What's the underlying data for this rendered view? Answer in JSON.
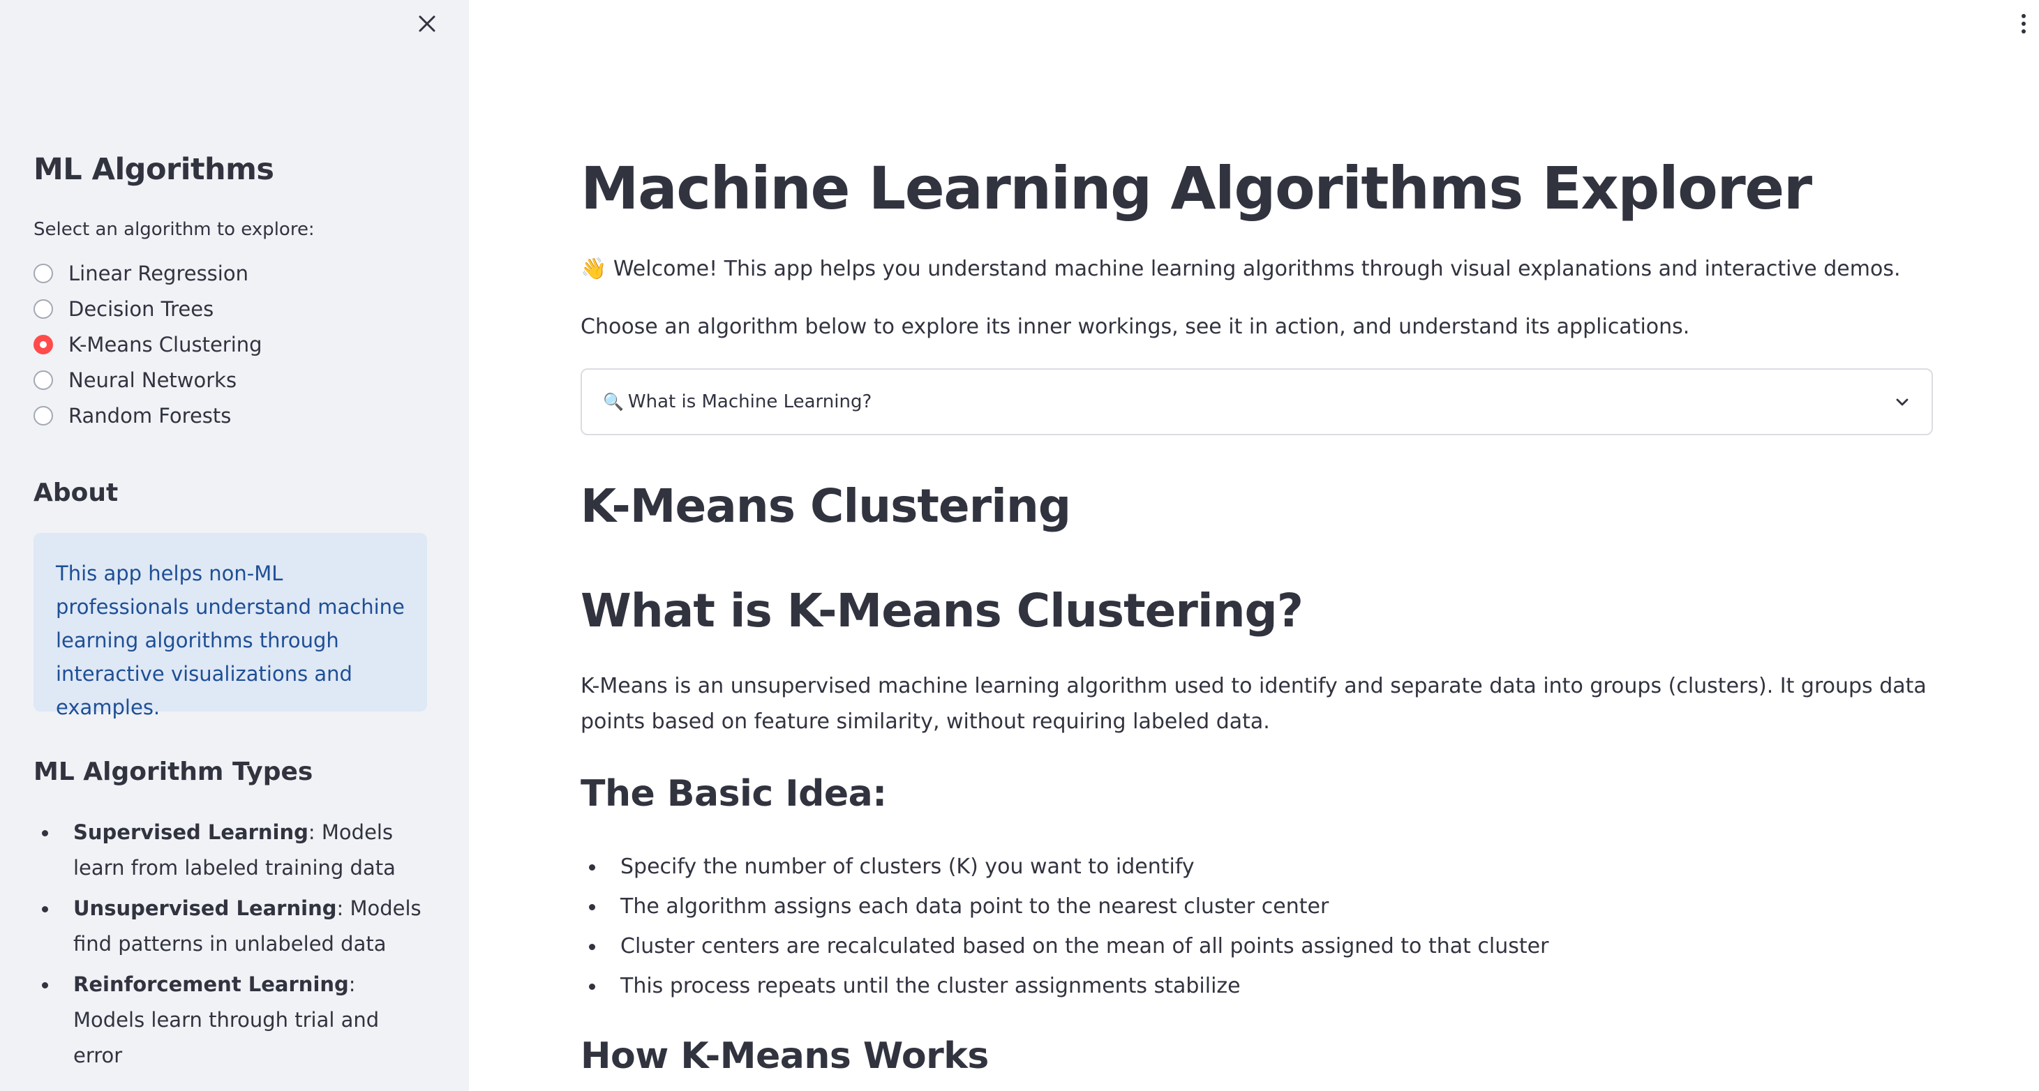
{
  "sidebar": {
    "title": "ML Algorithms",
    "prompt": "Select an algorithm to explore:",
    "options": [
      {
        "label": "Linear Regression",
        "checked": false
      },
      {
        "label": "Decision Trees",
        "checked": false
      },
      {
        "label": "K-Means Clustering",
        "checked": true
      },
      {
        "label": "Neural Networks",
        "checked": false
      },
      {
        "label": "Random Forests",
        "checked": false
      }
    ],
    "about_heading": "About",
    "about_text": "This app helps non-ML professionals understand machine learning algorithms through interactive visualizations and examples.",
    "types_heading": "ML Algorithm Types",
    "types": [
      {
        "name": "Supervised Learning",
        "desc": ": Models learn from labeled training data"
      },
      {
        "name": "Unsupervised Learning",
        "desc": ": Models find patterns in unlabeled data"
      },
      {
        "name": "Reinforcement Learning",
        "desc": ": Models learn through trial and error"
      }
    ]
  },
  "main": {
    "title": "Machine Learning Algorithms Explorer",
    "welcome_emoji": "👋",
    "welcome": "Welcome! This app helps you understand machine learning algorithms through visual explanations and interactive demos.",
    "choose": "Choose an algorithm below to explore its inner workings, see it in action, and understand its applications.",
    "expander_icon": "🔍",
    "expander_label": "What is Machine Learning?",
    "algo_heading": "K-Means Clustering",
    "what_heading": "What is K-Means Clustering?",
    "what_text": "K-Means is an unsupervised machine learning algorithm used to identify and separate data into groups (clusters). It groups data points based on feature similarity, without requiring labeled data.",
    "basic_heading": "The Basic Idea:",
    "basic_items": [
      "Specify the number of clusters (K) you want to identify",
      "The algorithm assigns each data point to the nearest cluster center",
      "Cluster centers are recalculated based on the mean of all points assigned to that cluster",
      "This process repeats until the cluster assignments stabilize"
    ],
    "how_heading": "How K-Means Works"
  },
  "colors": {
    "accent": "#ff4b4b",
    "sidebar_bg": "#f0f2f6",
    "info_bg": "#dfe8f5",
    "info_text": "#1e4f95",
    "text": "#31333f"
  },
  "icons": [
    "close-icon",
    "more-vert-icon",
    "magnifier-icon",
    "chevron-down-icon",
    "waving-hand-icon"
  ]
}
